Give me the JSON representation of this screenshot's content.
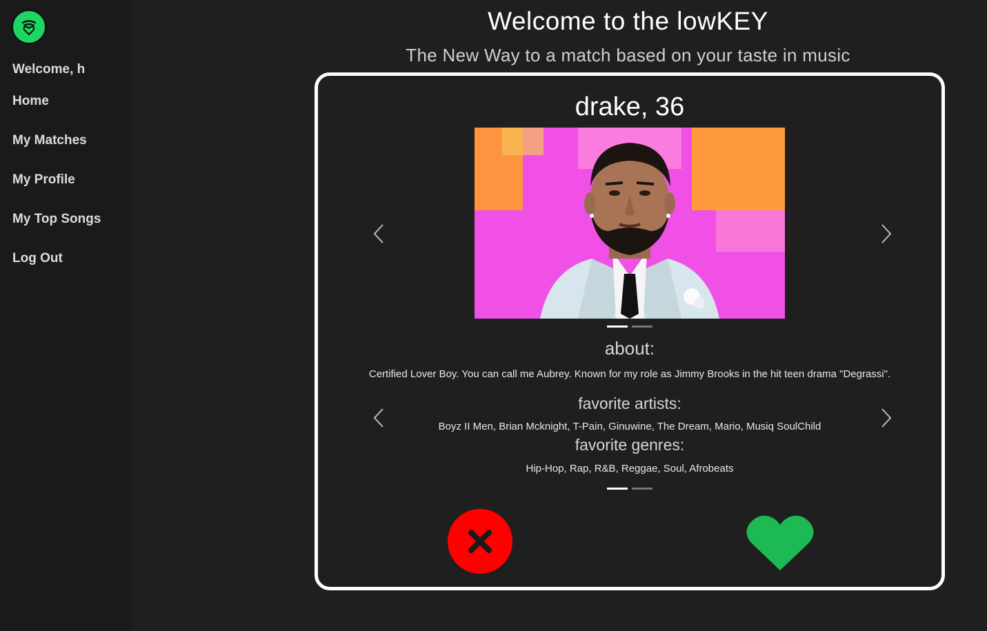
{
  "sidebar": {
    "welcome": "Welcome, h",
    "items": [
      {
        "label": "Home"
      },
      {
        "label": "My Matches"
      },
      {
        "label": "My Profile"
      },
      {
        "label": "My Top Songs"
      },
      {
        "label": "Log Out"
      }
    ]
  },
  "header": {
    "title": "Welcome to the lowKEY",
    "subtitle": "The New Way to a match based on your taste in music"
  },
  "profile": {
    "name_age": "drake, 36",
    "about_title": "about:",
    "about_text": "Certified Lover Boy. You can call me Aubrey. Known for my role as Jimmy Brooks in the hit teen drama \"Degrassi\".",
    "artists_title": "favorite artists:",
    "artists_text": "Boyz II Men, Brian Mcknight, T-Pain, Ginuwine, The Dream, Mario, Musiq SoulChild",
    "genres_title": "favorite genres:",
    "genres_text": "Hip-Hop, Rap, R&B, Reggae, Soul, Afrobeats"
  },
  "colors": {
    "accent_green": "#1ed760",
    "reject_red": "#ff0000",
    "like_green": "#1db954"
  },
  "icons": {
    "logo": "music-heart-logo",
    "prev": "chevron-left-icon",
    "next": "chevron-right-icon",
    "reject": "x-icon",
    "like": "heart-icon"
  }
}
